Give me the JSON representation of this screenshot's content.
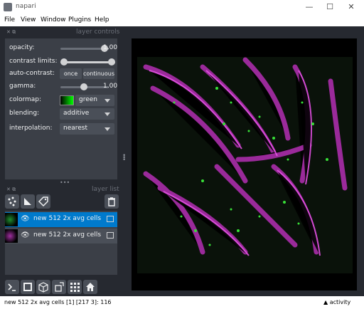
{
  "window": {
    "title": "napari",
    "controls": [
      "—",
      "☐",
      "✕"
    ]
  },
  "menu": [
    "File",
    "View",
    "Window",
    "Plugins",
    "Help"
  ],
  "layer_controls": {
    "title": "layer controls",
    "opacity": {
      "label": "opacity:",
      "value": "1.00",
      "level": 1.0
    },
    "contrast_limits": {
      "label": "contrast limits:"
    },
    "auto_contrast": {
      "label": "auto-contrast:",
      "once": "once",
      "continuous": "continuous"
    },
    "gamma": {
      "label": "gamma:",
      "value": "1.00",
      "level": 0.5
    },
    "colormap": {
      "label": "colormap:",
      "value": "green",
      "swatch_color": "#00ff00"
    },
    "blending": {
      "label": "blending:",
      "value": "additive"
    },
    "interpolation": {
      "label": "interpolation:",
      "value": "nearest"
    }
  },
  "layer_list": {
    "title": "layer list",
    "layers": [
      {
        "name": "new 512 2x avg cells [1]",
        "selected": true,
        "thumb_color": "#1f8f2f"
      },
      {
        "name": "new 512 2x avg cells",
        "selected": false,
        "thumb_color": "#a030a0"
      }
    ]
  },
  "status": {
    "text": "new 512 2x avg cells [1] [217  3]: 116",
    "activity": "activity"
  },
  "colors": {
    "selected": "#007acc",
    "panel": "#3b3f47",
    "background": "#262930",
    "magenta": "#d22fd2",
    "green": "#38e038"
  }
}
